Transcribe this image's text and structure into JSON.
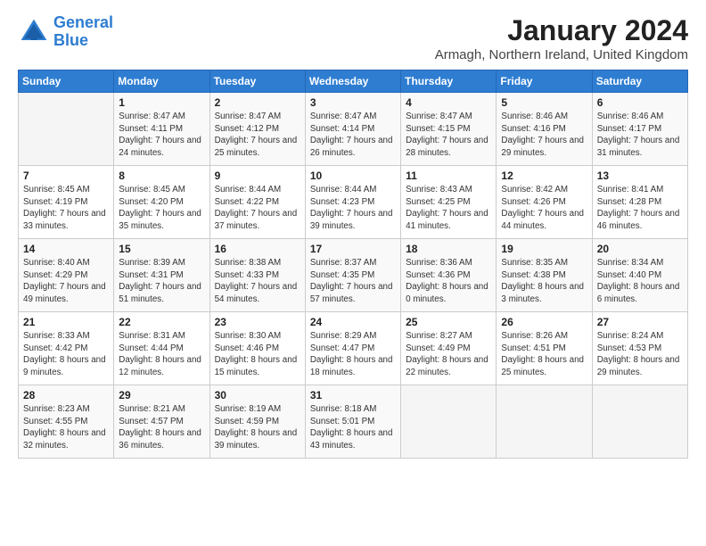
{
  "logo": {
    "line1": "General",
    "line2": "Blue"
  },
  "title": "January 2024",
  "subtitle": "Armagh, Northern Ireland, United Kingdom",
  "header": {
    "days": [
      "Sunday",
      "Monday",
      "Tuesday",
      "Wednesday",
      "Thursday",
      "Friday",
      "Saturday"
    ]
  },
  "weeks": [
    [
      {
        "day": "",
        "sunrise": "",
        "sunset": "",
        "daylight": ""
      },
      {
        "day": "1",
        "sunrise": "Sunrise: 8:47 AM",
        "sunset": "Sunset: 4:11 PM",
        "daylight": "Daylight: 7 hours and 24 minutes."
      },
      {
        "day": "2",
        "sunrise": "Sunrise: 8:47 AM",
        "sunset": "Sunset: 4:12 PM",
        "daylight": "Daylight: 7 hours and 25 minutes."
      },
      {
        "day": "3",
        "sunrise": "Sunrise: 8:47 AM",
        "sunset": "Sunset: 4:14 PM",
        "daylight": "Daylight: 7 hours and 26 minutes."
      },
      {
        "day": "4",
        "sunrise": "Sunrise: 8:47 AM",
        "sunset": "Sunset: 4:15 PM",
        "daylight": "Daylight: 7 hours and 28 minutes."
      },
      {
        "day": "5",
        "sunrise": "Sunrise: 8:46 AM",
        "sunset": "Sunset: 4:16 PM",
        "daylight": "Daylight: 7 hours and 29 minutes."
      },
      {
        "day": "6",
        "sunrise": "Sunrise: 8:46 AM",
        "sunset": "Sunset: 4:17 PM",
        "daylight": "Daylight: 7 hours and 31 minutes."
      }
    ],
    [
      {
        "day": "7",
        "sunrise": "Sunrise: 8:45 AM",
        "sunset": "Sunset: 4:19 PM",
        "daylight": "Daylight: 7 hours and 33 minutes."
      },
      {
        "day": "8",
        "sunrise": "Sunrise: 8:45 AM",
        "sunset": "Sunset: 4:20 PM",
        "daylight": "Daylight: 7 hours and 35 minutes."
      },
      {
        "day": "9",
        "sunrise": "Sunrise: 8:44 AM",
        "sunset": "Sunset: 4:22 PM",
        "daylight": "Daylight: 7 hours and 37 minutes."
      },
      {
        "day": "10",
        "sunrise": "Sunrise: 8:44 AM",
        "sunset": "Sunset: 4:23 PM",
        "daylight": "Daylight: 7 hours and 39 minutes."
      },
      {
        "day": "11",
        "sunrise": "Sunrise: 8:43 AM",
        "sunset": "Sunset: 4:25 PM",
        "daylight": "Daylight: 7 hours and 41 minutes."
      },
      {
        "day": "12",
        "sunrise": "Sunrise: 8:42 AM",
        "sunset": "Sunset: 4:26 PM",
        "daylight": "Daylight: 7 hours and 44 minutes."
      },
      {
        "day": "13",
        "sunrise": "Sunrise: 8:41 AM",
        "sunset": "Sunset: 4:28 PM",
        "daylight": "Daylight: 7 hours and 46 minutes."
      }
    ],
    [
      {
        "day": "14",
        "sunrise": "Sunrise: 8:40 AM",
        "sunset": "Sunset: 4:29 PM",
        "daylight": "Daylight: 7 hours and 49 minutes."
      },
      {
        "day": "15",
        "sunrise": "Sunrise: 8:39 AM",
        "sunset": "Sunset: 4:31 PM",
        "daylight": "Daylight: 7 hours and 51 minutes."
      },
      {
        "day": "16",
        "sunrise": "Sunrise: 8:38 AM",
        "sunset": "Sunset: 4:33 PM",
        "daylight": "Daylight: 7 hours and 54 minutes."
      },
      {
        "day": "17",
        "sunrise": "Sunrise: 8:37 AM",
        "sunset": "Sunset: 4:35 PM",
        "daylight": "Daylight: 7 hours and 57 minutes."
      },
      {
        "day": "18",
        "sunrise": "Sunrise: 8:36 AM",
        "sunset": "Sunset: 4:36 PM",
        "daylight": "Daylight: 8 hours and 0 minutes."
      },
      {
        "day": "19",
        "sunrise": "Sunrise: 8:35 AM",
        "sunset": "Sunset: 4:38 PM",
        "daylight": "Daylight: 8 hours and 3 minutes."
      },
      {
        "day": "20",
        "sunrise": "Sunrise: 8:34 AM",
        "sunset": "Sunset: 4:40 PM",
        "daylight": "Daylight: 8 hours and 6 minutes."
      }
    ],
    [
      {
        "day": "21",
        "sunrise": "Sunrise: 8:33 AM",
        "sunset": "Sunset: 4:42 PM",
        "daylight": "Daylight: 8 hours and 9 minutes."
      },
      {
        "day": "22",
        "sunrise": "Sunrise: 8:31 AM",
        "sunset": "Sunset: 4:44 PM",
        "daylight": "Daylight: 8 hours and 12 minutes."
      },
      {
        "day": "23",
        "sunrise": "Sunrise: 8:30 AM",
        "sunset": "Sunset: 4:46 PM",
        "daylight": "Daylight: 8 hours and 15 minutes."
      },
      {
        "day": "24",
        "sunrise": "Sunrise: 8:29 AM",
        "sunset": "Sunset: 4:47 PM",
        "daylight": "Daylight: 8 hours and 18 minutes."
      },
      {
        "day": "25",
        "sunrise": "Sunrise: 8:27 AM",
        "sunset": "Sunset: 4:49 PM",
        "daylight": "Daylight: 8 hours and 22 minutes."
      },
      {
        "day": "26",
        "sunrise": "Sunrise: 8:26 AM",
        "sunset": "Sunset: 4:51 PM",
        "daylight": "Daylight: 8 hours and 25 minutes."
      },
      {
        "day": "27",
        "sunrise": "Sunrise: 8:24 AM",
        "sunset": "Sunset: 4:53 PM",
        "daylight": "Daylight: 8 hours and 29 minutes."
      }
    ],
    [
      {
        "day": "28",
        "sunrise": "Sunrise: 8:23 AM",
        "sunset": "Sunset: 4:55 PM",
        "daylight": "Daylight: 8 hours and 32 minutes."
      },
      {
        "day": "29",
        "sunrise": "Sunrise: 8:21 AM",
        "sunset": "Sunset: 4:57 PM",
        "daylight": "Daylight: 8 hours and 36 minutes."
      },
      {
        "day": "30",
        "sunrise": "Sunrise: 8:19 AM",
        "sunset": "Sunset: 4:59 PM",
        "daylight": "Daylight: 8 hours and 39 minutes."
      },
      {
        "day": "31",
        "sunrise": "Sunrise: 8:18 AM",
        "sunset": "Sunset: 5:01 PM",
        "daylight": "Daylight: 8 hours and 43 minutes."
      },
      {
        "day": "",
        "sunrise": "",
        "sunset": "",
        "daylight": ""
      },
      {
        "day": "",
        "sunrise": "",
        "sunset": "",
        "daylight": ""
      },
      {
        "day": "",
        "sunrise": "",
        "sunset": "",
        "daylight": ""
      }
    ]
  ]
}
